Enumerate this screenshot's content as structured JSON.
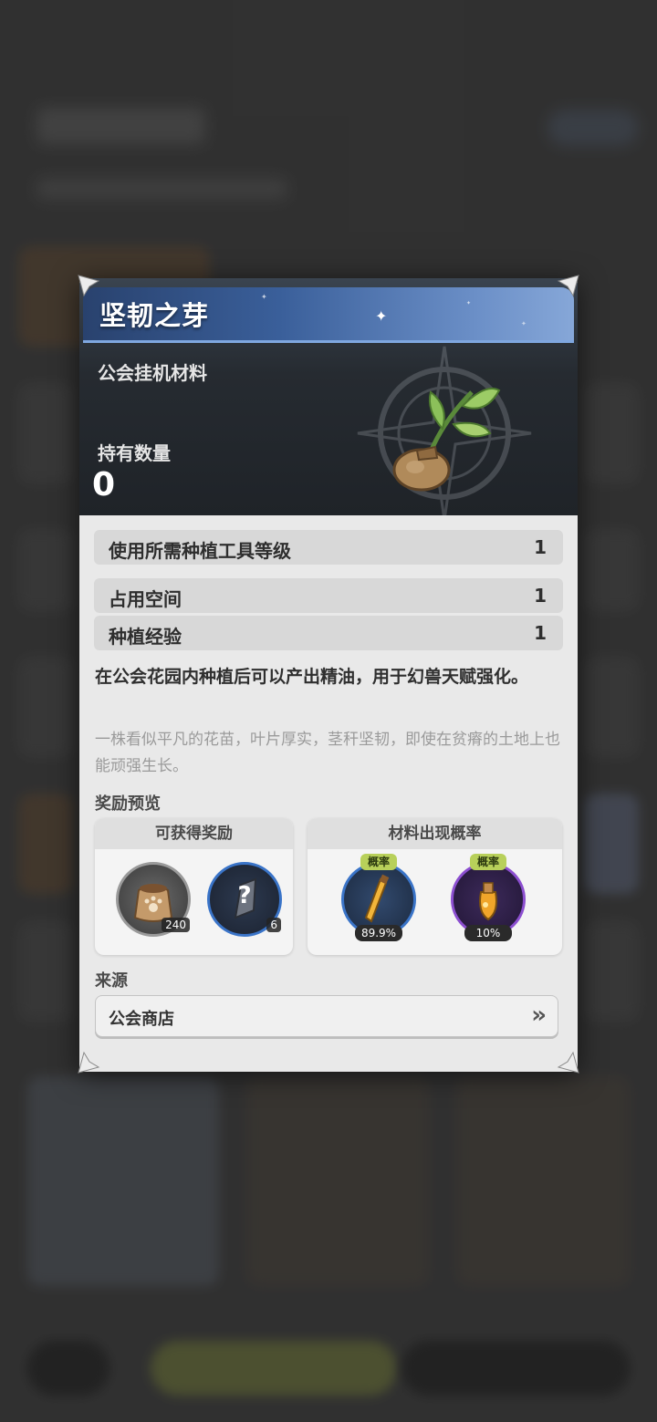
{
  "item": {
    "name": "坚韧之芽",
    "category": "公会挂机材料",
    "held_label": "持有数量",
    "held_count": "0"
  },
  "stats": [
    {
      "label": "使用所需种植工具等级",
      "value": "1"
    },
    {
      "label": "占用空间",
      "value": "1"
    },
    {
      "label": "种植经验",
      "value": "1"
    }
  ],
  "description": "在公会花园内种植后可以产出精油，用于幻兽天赋强化。",
  "flavor_text": "一株看似平凡的花苗，叶片厚实，茎秆坚韧，即使在贫瘠的土地上也能顽强生长。",
  "reward_preview": {
    "label": "奖励预览",
    "obtainable": {
      "title": "可获得奖励",
      "items": [
        {
          "icon": "seed-bag-icon",
          "count": "240"
        },
        {
          "icon": "mystery-crystal-icon",
          "count": "6"
        }
      ]
    },
    "material_chance": {
      "title": "材料出现概率",
      "items": [
        {
          "icon": "essential-oil-vial-icon",
          "tag": "概率",
          "percent": "89.9%"
        },
        {
          "icon": "rare-oil-bottle-icon",
          "tag": "概率",
          "percent": "10%"
        }
      ]
    }
  },
  "source": {
    "label": "来源",
    "entry": "公会商店"
  },
  "colors": {
    "title_bar": "#3a5f9a",
    "rate_tag": "#b8d05a",
    "blue_ring": "#3a74c8",
    "purple_ring": "#8c4fd0"
  }
}
